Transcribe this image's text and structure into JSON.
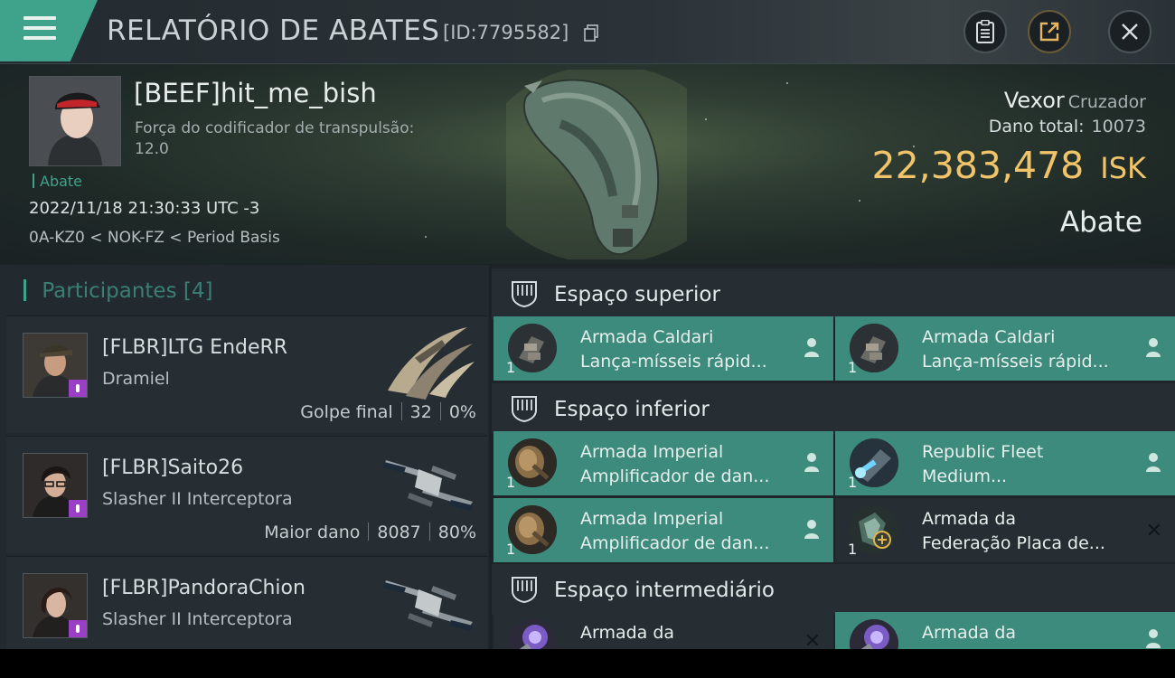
{
  "header": {
    "title": "RELATÓRIO DE ABATES",
    "report_id": "[ID:7795582]",
    "icons": [
      "menu-icon",
      "copy-icon",
      "clipboard-icon",
      "share-icon",
      "close-icon"
    ]
  },
  "victim": {
    "pilot": "[BEEF]hit_me_bish",
    "stat_label": "Força do codificador de transpulsão:",
    "stat_value": "12.0",
    "tag": "Abate",
    "datetime": "2022/11/18 21:30:33 UTC -3",
    "location": "0A-KZ0 < NOK-FZ < Period Basis",
    "ship": "Vexor",
    "ship_class": "Cruzador",
    "damage_label": "Dano total:",
    "damage_value": "10073",
    "isk_value": "22,383,478",
    "isk_unit": "ISK",
    "result": "Abate"
  },
  "participants": {
    "title": "Participantes",
    "count": "[4]",
    "items": [
      {
        "name": "[FLBR]LTG EndeRR",
        "ship": "Dramiel",
        "label": "Golpe final",
        "damage": "32",
        "percent": "0%"
      },
      {
        "name": "[FLBR]Saito26",
        "ship": "Slasher II Interceptora",
        "label": "Maior dano",
        "damage": "8087",
        "percent": "80%"
      },
      {
        "name": "[FLBR]PandoraChion",
        "ship": "Slasher II Interceptora"
      }
    ]
  },
  "fitting": {
    "high": {
      "title": "Espaço superior",
      "slots": [
        {
          "qty": "1",
          "line1": "Armada Caldari",
          "line2": "Lança-mísseis rápid...",
          "icon": "missile-launcher-icon"
        },
        {
          "qty": "1",
          "line1": "Armada Caldari",
          "line2": "Lança-mísseis rápid...",
          "icon": "missile-launcher-icon"
        }
      ]
    },
    "low": {
      "title": "Espaço inferior",
      "slots": [
        {
          "qty": "1",
          "line1": "Armada Imperial",
          "line2": "Amplificador de dan...",
          "icon": "damage-amplifier-icon"
        },
        {
          "qty": "1",
          "line1": "Republic Fleet",
          "line2": "Medium...",
          "icon": "blue-module-icon"
        },
        {
          "qty": "1",
          "line1": "Armada Imperial",
          "line2": "Amplificador de dan...",
          "icon": "damage-amplifier-icon"
        },
        {
          "qty": "1",
          "line1": "Armada da",
          "line2": "Federação Placa de...",
          "icon": "armor-plate-icon"
        }
      ]
    },
    "mid": {
      "title": "Espaço intermediário",
      "slots": [
        {
          "line1": "Armada da",
          "icon": "purple-module-icon"
        },
        {
          "line1": "Armada da",
          "icon": "purple-module-icon"
        }
      ]
    }
  }
}
